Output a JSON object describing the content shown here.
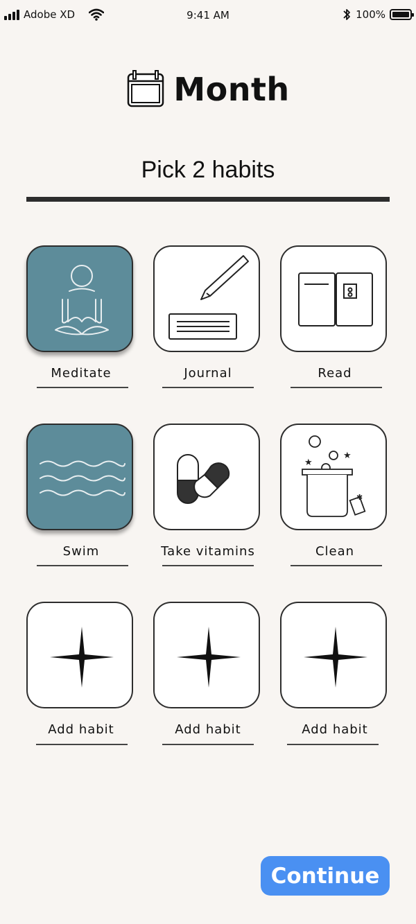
{
  "status_bar": {
    "carrier": "Adobe XD",
    "time": "9:41 AM",
    "battery": "100%",
    "battery_level": 1.0
  },
  "header": {
    "title": "Month",
    "icon": "calendar-icon"
  },
  "prompt": "Pick 2 habits",
  "habits": [
    {
      "label": "Meditate",
      "icon": "meditate-icon",
      "selected": true
    },
    {
      "label": "Journal",
      "icon": "journal-icon",
      "selected": false
    },
    {
      "label": "Read",
      "icon": "book-icon",
      "selected": false
    },
    {
      "label": "Swim",
      "icon": "waves-icon",
      "selected": true
    },
    {
      "label": "Take vitamins",
      "icon": "pill-icon",
      "selected": false
    },
    {
      "label": "Clean",
      "icon": "cleaning-bucket-icon",
      "selected": false
    },
    {
      "label": "Add habit",
      "icon": "sparkle-icon",
      "selected": false
    },
    {
      "label": "Add habit",
      "icon": "sparkle-icon",
      "selected": false
    },
    {
      "label": "Add habit",
      "icon": "sparkle-icon",
      "selected": false
    }
  ],
  "continue_label": "Continue",
  "colors": {
    "background": "#f8f5f2",
    "selected_tile": "#5d8c9a",
    "button": "#4a90f2"
  }
}
